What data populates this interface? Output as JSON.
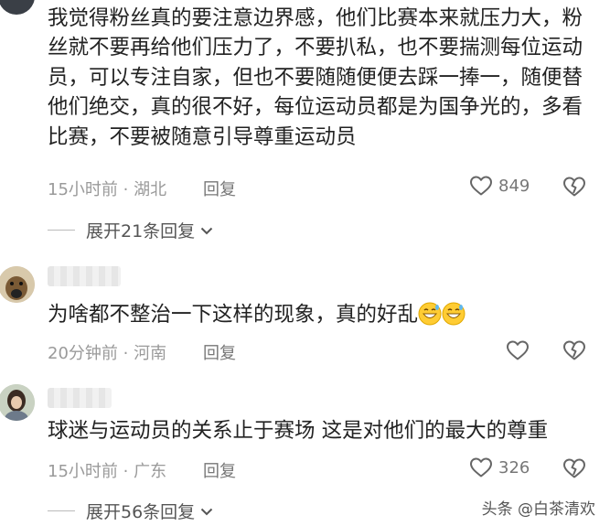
{
  "comments": [
    {
      "text": "我觉得粉丝真的要注意边界感，他们比赛本来就压力大，粉丝就不要再给他们压力了，不要扒私，也不要揣测每位运动员，可以专注自家，但也不要随随便便去踩一捧一，随便替他们绝交，真的很不好，每位运动员都是为国争光的，多看比赛，不要被随意引导尊重运动员",
      "meta": "15小时前 · 湖北",
      "reply_label": "回复",
      "likes": "849"
    },
    {
      "text": "为啥都不整治一下这样的现象，真的好乱",
      "emoji": "grinning-sweat-emoji",
      "meta": "20分钟前 · 河南",
      "reply_label": "回复",
      "likes": ""
    },
    {
      "text": "球迷与运动员的关系止于赛场 这是对他们的最大的尊重",
      "meta": "15小时前 · 广东",
      "reply_label": "回复",
      "likes": "326"
    }
  ],
  "expand_replies": [
    {
      "label": "展开21条回复"
    },
    {
      "label": "展开56条回复"
    }
  ],
  "watermark": "头条 @白茶清欢",
  "icons": {
    "like": "heart-outline-icon",
    "dislike": "broken-heart-icon",
    "expand": "chevron-down-icon"
  }
}
